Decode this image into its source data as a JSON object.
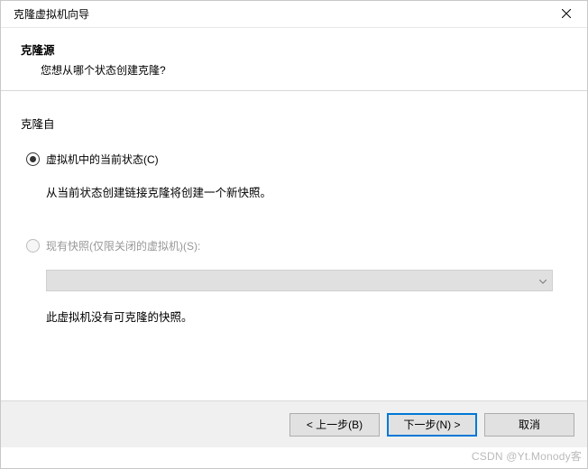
{
  "window": {
    "title": "克隆虚拟机向导"
  },
  "header": {
    "title": "克隆源",
    "subtitle": "您想从哪个状态创建克隆?"
  },
  "content": {
    "group_label": "克隆自",
    "option1": {
      "label": "虚拟机中的当前状态(C)",
      "desc": "从当前状态创建链接克隆将创建一个新快照。"
    },
    "option2": {
      "label": "现有快照(仅限关闭的虚拟机)(S):"
    },
    "snapshot_note": "此虚拟机没有可克隆的快照。"
  },
  "footer": {
    "back": "< 上一步(B)",
    "next": "下一步(N) >",
    "cancel": "取消"
  },
  "watermark": "CSDN @Yt.Monody客"
}
